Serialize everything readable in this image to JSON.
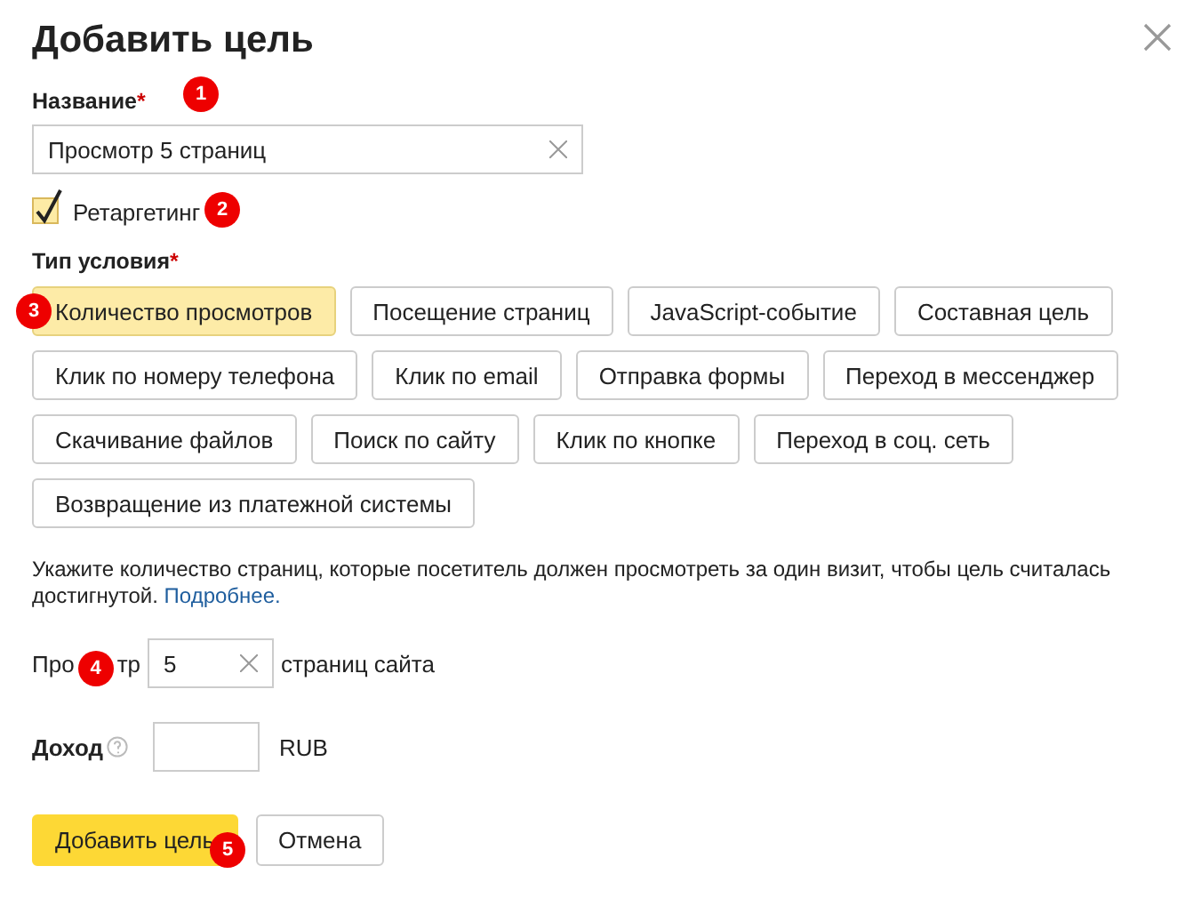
{
  "dialog": {
    "title": "Добавить цель"
  },
  "name_field": {
    "label": "Название",
    "required_mark": "*",
    "value": "Просмотр 5 страниц",
    "marker": "1"
  },
  "retargeting": {
    "label": "Ретаргетинг",
    "checked": true,
    "marker": "2"
  },
  "condition": {
    "label": "Тип условия",
    "required_mark": "*"
  },
  "condition_types": [
    {
      "label": "Количество просмотров",
      "selected": true,
      "marker": "3"
    },
    {
      "label": "Посещение страниц",
      "selected": false
    },
    {
      "label": "JavaScript-событие",
      "selected": false
    },
    {
      "label": "Составная цель",
      "selected": false
    },
    {
      "label": "Клик по номеру телефона",
      "selected": false
    },
    {
      "label": "Клик по email",
      "selected": false
    },
    {
      "label": "Отправка формы",
      "selected": false
    },
    {
      "label": "Переход в мессенджер",
      "selected": false
    },
    {
      "label": "Скачивание файлов",
      "selected": false
    },
    {
      "label": "Поиск по сайту",
      "selected": false
    },
    {
      "label": "Клик по кнопке",
      "selected": false
    },
    {
      "label": "Переход в соц. сеть",
      "selected": false
    },
    {
      "label": "Возвращение из платежной системы",
      "selected": false
    }
  ],
  "hint": {
    "text": "Укажите количество страниц, которые посетитель должен просмотреть за один визит, чтобы цель считалась достигнутой.",
    "link": "Подробнее."
  },
  "pages": {
    "label_parts": [
      "Про",
      "тр"
    ],
    "value": "5",
    "suffix": "страниц сайта",
    "marker": "4"
  },
  "income": {
    "label": "Доход",
    "currency": "RUB"
  },
  "buttons": [
    {
      "label": "Добавить цель",
      "kind": "primary",
      "marker": "5"
    },
    {
      "label": "Отмена",
      "kind": "secondary"
    }
  ]
}
